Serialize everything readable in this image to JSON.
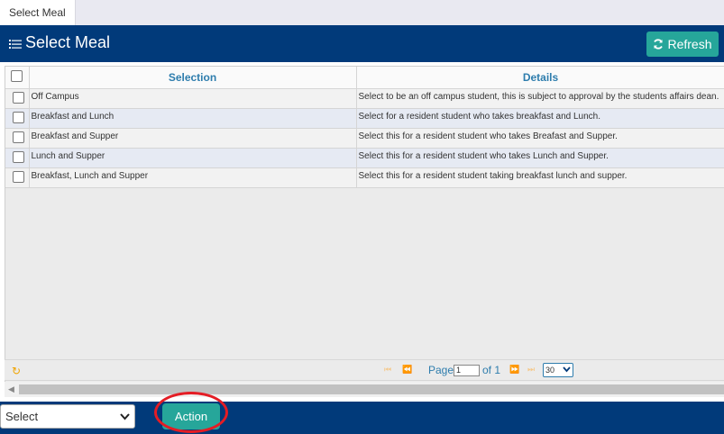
{
  "tab": {
    "label": "Select Meal"
  },
  "header": {
    "title": "Select Meal",
    "title_icon": "list-icon",
    "refresh_label": "Refresh",
    "refresh_icon": "refresh-icon"
  },
  "grid": {
    "columns": [
      "Selection",
      "Details"
    ],
    "rows": [
      {
        "selection": "Off Campus",
        "details": "Select to be an off campus student, this is subject to approval by the students affairs dean."
      },
      {
        "selection": "Breakfast and Lunch",
        "details": "Select for a resident student who takes breakfast and Lunch."
      },
      {
        "selection": "Breakfast and Supper",
        "details": "Select this for a resident student who takes Breafast and Supper."
      },
      {
        "selection": "Lunch and Supper",
        "details": "Select this for a resident student who takes Lunch and Supper."
      },
      {
        "selection": "Breakfast, Lunch and Supper",
        "details": "Select this for a resident student taking breakfast lunch and supper."
      }
    ]
  },
  "pager": {
    "page_label": "Page",
    "page_value": "1",
    "of_label": "of 1",
    "rows_per_page": "30"
  },
  "footer": {
    "select_value": "Select",
    "action_label": "Action"
  },
  "colors": {
    "header_bg": "#013a7a",
    "button_teal": "#26a69a",
    "column_header_text": "#2e7dad",
    "highlight": "#e41c24"
  }
}
